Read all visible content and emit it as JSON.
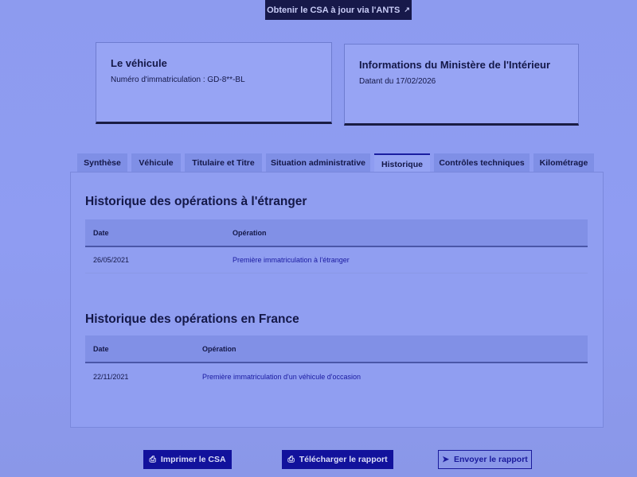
{
  "top_button": {
    "label": "Obtenir le CSA à jour via l'ANTS",
    "icon": "external-link-icon"
  },
  "vehicle_card": {
    "title": "Le véhicule",
    "plate": "Numéro d'immatriculation : GD-8**-BL"
  },
  "ministry_card": {
    "title": "Informations du Ministère de l'Intérieur",
    "date": "Datant du 17/02/2026"
  },
  "tabs": [
    {
      "label": "Synthèse"
    },
    {
      "label": "Véhicule"
    },
    {
      "label": "Titulaire et Titre"
    },
    {
      "label": "Situation administrative"
    },
    {
      "label": "Historique",
      "active": true
    },
    {
      "label": "Contrôles techniques"
    },
    {
      "label": "Kilométrage"
    }
  ],
  "foreign": {
    "title": "Historique des opérations à l'étranger",
    "columns": [
      "Date",
      "Opération"
    ],
    "rows": [
      {
        "date": "26/05/2021",
        "operation": "Première immatriculation à l'étranger"
      }
    ]
  },
  "france": {
    "title": "Historique des opérations en France",
    "columns": [
      "Date",
      "Opération"
    ],
    "rows": [
      {
        "date": "22/11/2021",
        "operation": "Première immatriculation d'un véhicule d'occasion"
      }
    ]
  },
  "actions": {
    "print": "Imprimer le CSA",
    "download": "Télécharger le rapport",
    "send": "Envoyer le rapport"
  }
}
